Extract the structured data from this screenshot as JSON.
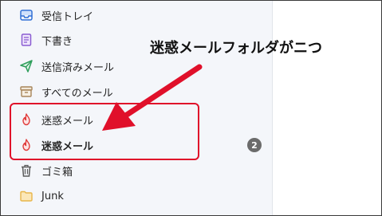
{
  "sidebar": {
    "items": [
      {
        "label": "受信トレイ",
        "icon": "inbox-icon"
      },
      {
        "label": "下書き",
        "icon": "draft-icon"
      },
      {
        "label": "送信済みメール",
        "icon": "send-icon"
      },
      {
        "label": "すべてのメール",
        "icon": "archive-icon"
      },
      {
        "label": "迷惑メール",
        "icon": "junk-flame-icon"
      },
      {
        "label": "迷惑メール",
        "icon": "junk-flame-icon"
      },
      {
        "label": "ゴミ箱",
        "icon": "trash-icon"
      },
      {
        "label": "Junk",
        "icon": "folder-icon"
      }
    ],
    "junk_unread_count": "2"
  },
  "annotation": {
    "text": "迷惑メールフォルダがニつ"
  },
  "colors": {
    "highlight_red": "#e0102a",
    "flame_red": "#e03b3b",
    "accent_blue": "#2f6fd6",
    "draft_purple": "#8a5cd1",
    "send_green": "#2e9e5b",
    "archive_brown": "#a8865a",
    "folder_yellow": "#e8b64a"
  }
}
